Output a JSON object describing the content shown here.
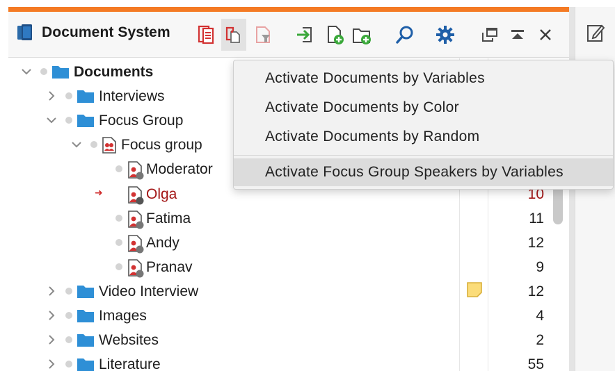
{
  "app": {
    "title": "Document System",
    "accent_color": "#f47a24"
  },
  "toolbar": {
    "buttons": [
      {
        "name": "retrieved-segments-icon",
        "active": false
      },
      {
        "name": "activate-documents-icon",
        "active": true
      },
      {
        "name": "reset-activations-icon",
        "active": false
      },
      {
        "name": "import-documents-icon",
        "active": false
      },
      {
        "name": "new-document-icon",
        "active": false
      },
      {
        "name": "new-document-group-icon",
        "active": false
      },
      {
        "name": "search-icon",
        "active": false
      },
      {
        "name": "settings-icon",
        "active": false
      },
      {
        "name": "undock-window-icon",
        "active": false
      },
      {
        "name": "maximize-window-icon",
        "active": false
      },
      {
        "name": "close-icon",
        "active": false
      }
    ]
  },
  "tree": {
    "rows": [
      {
        "label": "Documents",
        "level": 0,
        "type": "folder",
        "expanded": true,
        "bold": true,
        "count": ""
      },
      {
        "label": "Interviews",
        "level": 1,
        "type": "folder",
        "expanded": false,
        "count": ""
      },
      {
        "label": "Focus Group",
        "level": 1,
        "type": "folder",
        "expanded": true,
        "count": ""
      },
      {
        "label": "Focus group",
        "level": 2,
        "type": "focus-group-document",
        "expanded": true,
        "count": ""
      },
      {
        "label": "Moderator",
        "level": 3,
        "type": "speaker",
        "count": ""
      },
      {
        "label": "Olga",
        "level": 3,
        "type": "speaker",
        "active": true,
        "count": "10"
      },
      {
        "label": "Fatima",
        "level": 3,
        "type": "speaker",
        "count": "11"
      },
      {
        "label": "Andy",
        "level": 3,
        "type": "speaker",
        "count": "12"
      },
      {
        "label": "Pranav",
        "level": 3,
        "type": "speaker",
        "count": "9"
      },
      {
        "label": "Video Interview",
        "level": 1,
        "type": "folder",
        "expanded": false,
        "count": "12",
        "memo": true
      },
      {
        "label": "Images",
        "level": 1,
        "type": "folder",
        "expanded": false,
        "count": "4"
      },
      {
        "label": "Websites",
        "level": 1,
        "type": "folder",
        "expanded": false,
        "count": "2"
      },
      {
        "label": "Literature",
        "level": 1,
        "type": "folder",
        "expanded": false,
        "count": "55"
      }
    ]
  },
  "context_menu": {
    "items": [
      {
        "label": "Activate Documents by Variables",
        "hover": false
      },
      {
        "label": "Activate Documents by Color",
        "hover": false
      },
      {
        "label": "Activate Documents by Random",
        "hover": false
      },
      {
        "label": "Activate Focus Group Speakers by Variables",
        "hover": true
      }
    ]
  },
  "colors": {
    "folder": "#2e8fd6",
    "speaker_red": "#d23232",
    "active_text": "#a31616"
  }
}
